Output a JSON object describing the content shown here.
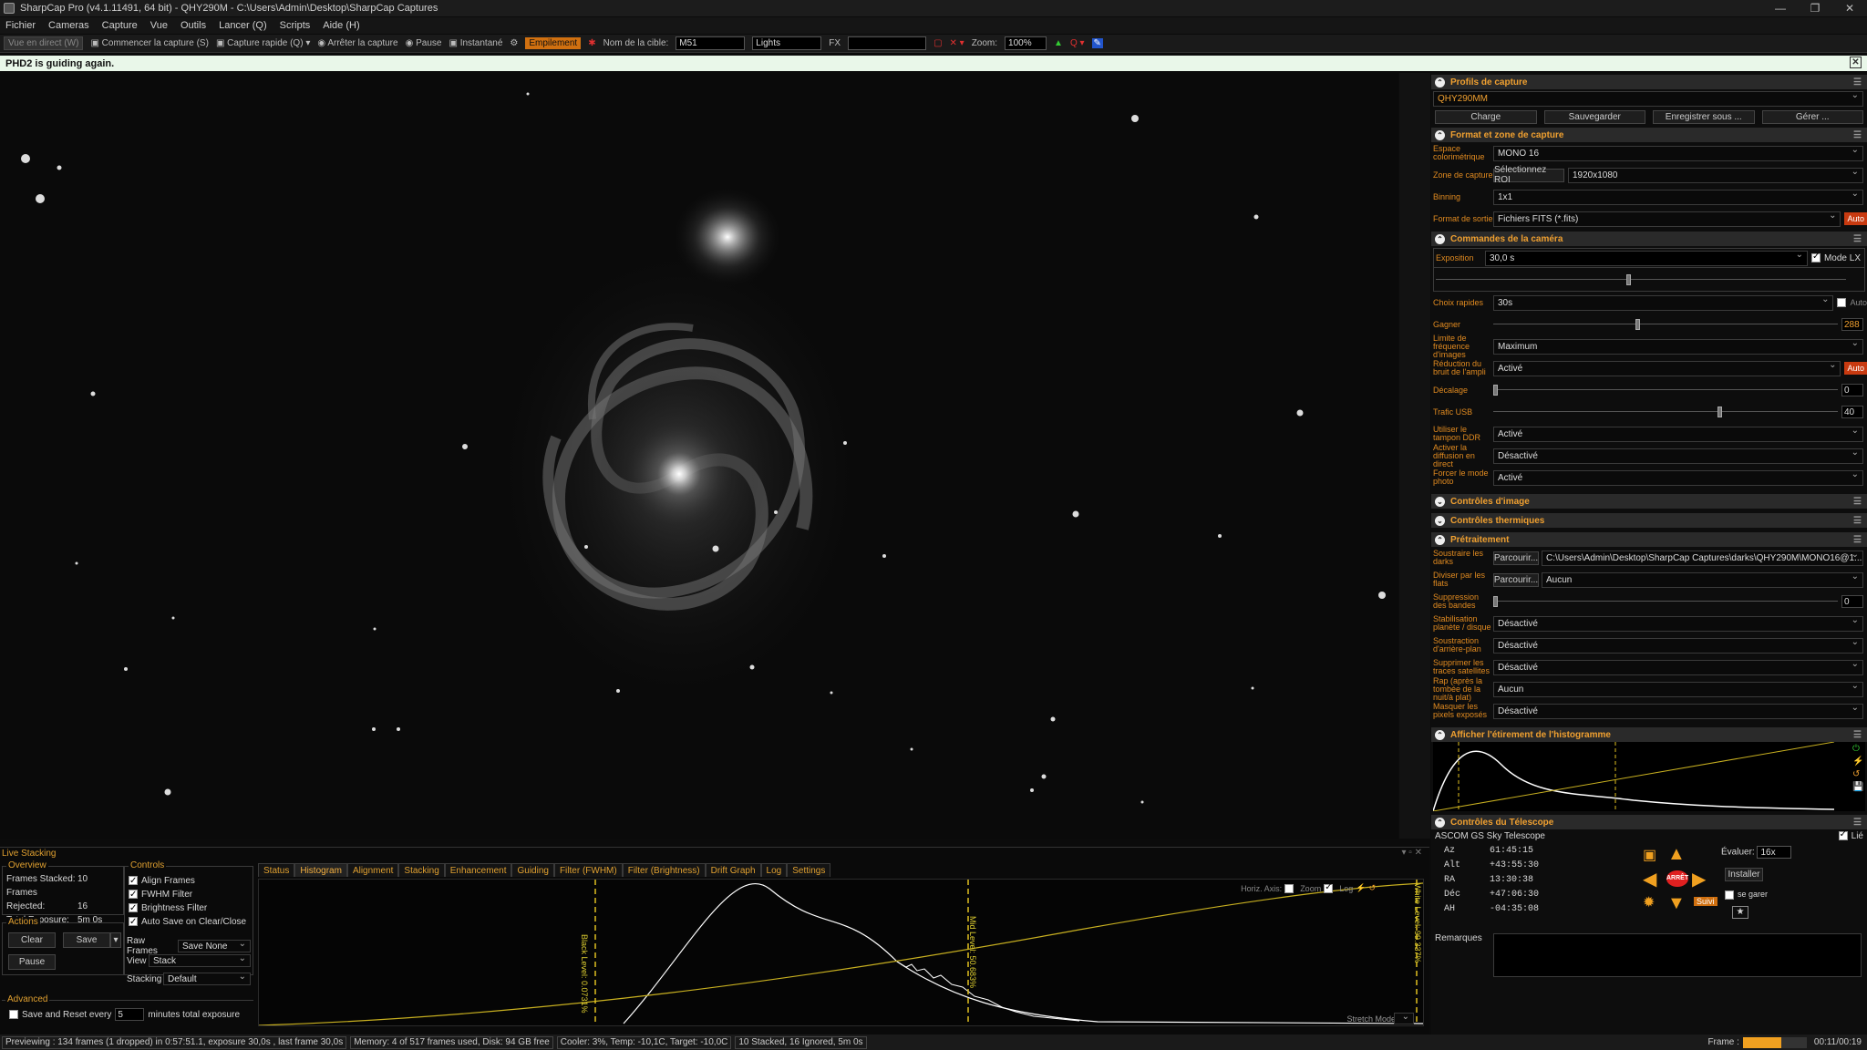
{
  "window": {
    "title": "SharpCap Pro (v4.1.11491, 64 bit) - QHY290M - C:\\Users\\Admin\\Desktop\\SharpCap Captures"
  },
  "menu": [
    "Fichier",
    "Cameras",
    "Capture",
    "Vue",
    "Outils",
    "Lancer (Q)",
    "Scripts",
    "Aide (H)"
  ],
  "toolbar": {
    "live_view": "Vue en direct (W)",
    "start_capture": "Commencer la capture (S)",
    "quick_capture": "Capture rapide (Q)",
    "stop_capture": "Arrêter la capture",
    "pause": "Pause",
    "snapshot": "Instantané",
    "stacking": "Empilement",
    "target_label": "Nom de la cible:",
    "target_value": "M51",
    "frame_type": "Lights",
    "fx_label": "FX",
    "zoom_label": "Zoom:",
    "zoom_value": "100%"
  },
  "notification": "PHD2 is guiding again.",
  "right_panel": {
    "profiles": {
      "title": "Profils de capture",
      "value": "QHY290MM",
      "buttons": [
        "Charge",
        "Sauvegarder",
        "Enregistrer sous ...",
        "Gérer ..."
      ]
    },
    "format": {
      "title": "Format et zone de capture",
      "rows": [
        {
          "label": "Espace colorimétrique",
          "value": "MONO 16"
        },
        {
          "label": "Zone de capture",
          "button": "Sélectionnez ROI",
          "value": "1920x1080"
        },
        {
          "label": "Binning",
          "value": "1x1"
        },
        {
          "label": "Format de sortie",
          "value": "Fichiers FITS (*.fits)",
          "auto": "Auto"
        }
      ]
    },
    "camera": {
      "title": "Commandes de la caméra",
      "exposure_label": "Exposition",
      "exposure_value": "30,0 s",
      "lx_mode": "Mode LX",
      "quick_label": "Choix rapides",
      "quick_value": "30s",
      "auto": "Auto",
      "gain_label": "Gagner",
      "gain_value": "288",
      "gain_fraction": 0.42,
      "exposure_fraction": 0.47,
      "rows": [
        {
          "label": "Limite de fréquence d'images",
          "value": "Maximum"
        },
        {
          "label": "Réduction du bruit de l'ampli",
          "value": "Activé",
          "auto": "Auto"
        }
      ],
      "offset_label": "Décalage",
      "offset_value": "0",
      "usb_label": "Trafic USB",
      "usb_value": "40",
      "usb_fraction": 0.66,
      "rows2": [
        {
          "label": "Utiliser le tampon DDR",
          "value": "Activé"
        },
        {
          "label": "Activer la diffusion en direct",
          "value": "Désactivé"
        },
        {
          "label": "Forcer le mode photo",
          "value": "Activé"
        }
      ]
    },
    "image_controls": "Contrôles d'image",
    "thermal_controls": "Contrôles thermiques",
    "preprocessing": {
      "title": "Prétraitement",
      "darks_label": "Soustraire les darks",
      "browse": "Parcourir...",
      "darks_value": "C:\\Users\\Admin\\Desktop\\SharpCap Captures\\darks\\QHY290M\\MONO16@1...",
      "flats_label": "Diviser par les flats",
      "flats_value": "Aucun",
      "banding_label": "Suppression des bandes",
      "banding_value": "0",
      "rows": [
        {
          "label": "Stabilisation planète / disque",
          "value": "Désactivé"
        },
        {
          "label": "Soustraction d'arrière-plan",
          "value": "Désactivé"
        },
        {
          "label": "Supprimer les traces satellites",
          "value": "Désactivé"
        },
        {
          "label": "Rap (après la tombée de la nuit/à plat)",
          "value": "Aucun"
        },
        {
          "label": "Masquer les pixels exposés",
          "value": "Désactivé"
        }
      ]
    },
    "histogram_title": "Afficher l'étirement de l'histogramme",
    "telescope": {
      "title": "Contrôles du Télescope",
      "linked": "Lié",
      "name": "ASCOM GS Sky Telescope",
      "coords": [
        {
          "k": "Az",
          "v": "61:45:15"
        },
        {
          "k": "Alt",
          "v": "+43:55:30"
        },
        {
          "k": "RA",
          "v": "13:30:38"
        },
        {
          "k": "Déc",
          "v": "+47:06:30"
        },
        {
          "k": "AH",
          "v": "-04:35:08"
        }
      ],
      "rate_label": "Évaluer:",
      "rate_value": "16x",
      "install": "Installer",
      "park": "se garer",
      "stop": "ARRÊT",
      "follow": "Suivi",
      "notes_label": "Remarques"
    }
  },
  "live_stacking": {
    "title": "Live Stacking",
    "overview": {
      "title": "Overview",
      "frames_stacked_label": "Frames Stacked:",
      "frames_stacked": "10",
      "frames_rejected_label": "Frames Rejected:",
      "frames_rejected": "16",
      "total_exposure_label": "Total Exposure:",
      "total_exposure": "5m 0s"
    },
    "actions": {
      "title": "Actions",
      "clear": "Clear",
      "save": "Save",
      "pause": "Pause"
    },
    "controls": {
      "title": "Controls",
      "checks": [
        "Align Frames",
        "FWHM Filter",
        "Brightness Filter",
        "Auto Save on Clear/Close"
      ],
      "raw_frames_label": "Raw Frames",
      "raw_frames_value": "Save None",
      "view_label": "View",
      "view_value": "Stack",
      "stacking_label": "Stacking",
      "stacking_value": "Default"
    },
    "advanced": {
      "title": "Advanced",
      "save_reset": "Save and Reset every",
      "minutes": "5",
      "suffix": "minutes total exposure"
    },
    "tabs": [
      "Status",
      "Histogram",
      "Alignment",
      "Stacking",
      "Enhancement",
      "Guiding",
      "Filter (FWHM)",
      "Filter (Brightness)",
      "Drift Graph",
      "Log",
      "Settings"
    ],
    "active_tab": "Histogram",
    "histogram": {
      "horiz_axis": "Horiz. Axis:",
      "zoom": "Zoom",
      "log": "Log",
      "black_level": "Black Level: 0.0731%",
      "mid_level": "Mid Level: 50.683%",
      "white_level": "White Level: 99.337%",
      "stretch_mode": "Stretch Mode"
    }
  },
  "status_bar": {
    "previewing": "Previewing : 134 frames (1 dropped) in 0:57:51.1, exposure 30,0s , last frame 30,0s",
    "memory": "Memory: 4 of 517 frames used, Disk: 94 GB free",
    "cooler": "Cooler: 3%, Temp: -10,1C, Target: -10,0C",
    "stacked": "10 Stacked, 16 Ignored, 5m 0s",
    "frame_label": "Frame :",
    "frame_time": "00:11/00:19",
    "frame_progress": 0.6
  },
  "colors": {
    "accent": "#e0a030",
    "notif_bg": "#e9f7e9",
    "stack_btn": "#d07010",
    "stop_red": "#e02020",
    "arrow": "#f0a020"
  }
}
